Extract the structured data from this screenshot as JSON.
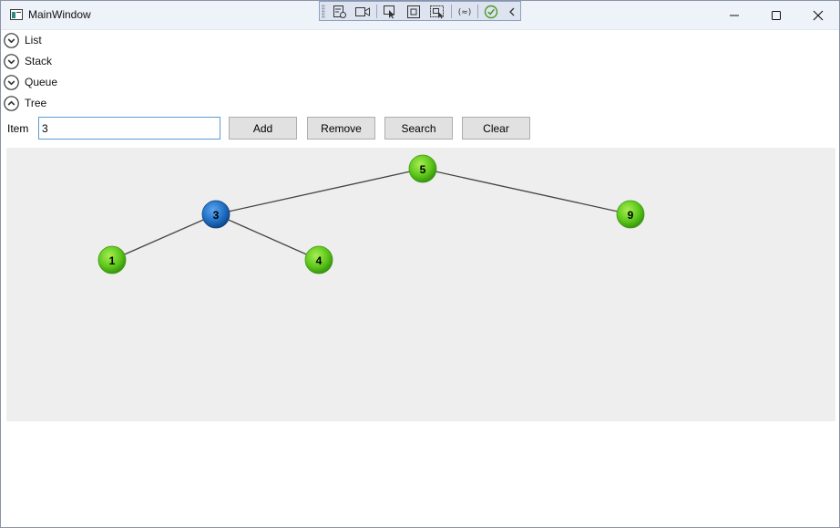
{
  "window": {
    "title": "MainWindow",
    "app_icon": "window-icon",
    "controls": [
      "minimize-icon",
      "maximize-icon",
      "close-icon"
    ]
  },
  "dev_toolbar": {
    "icons": [
      "live-visual-tree-icon",
      "record-icon",
      "select-element-icon",
      "display-layout-adorners-icon",
      "track-focus-icon",
      "binding-failures-icon",
      "check-icon",
      "collapse-chevron-icon"
    ]
  },
  "expanders": [
    {
      "label": "List",
      "expanded": false
    },
    {
      "label": "Stack",
      "expanded": false
    },
    {
      "label": "Queue",
      "expanded": false
    },
    {
      "label": "Tree",
      "expanded": true
    }
  ],
  "controls": {
    "item_label": "Item",
    "item_value": "3",
    "add_label": "Add",
    "remove_label": "Remove",
    "search_label": "Search",
    "clear_label": "Clear"
  },
  "tree": {
    "nodes": [
      {
        "id": "n5",
        "label": "5",
        "highlighted": false
      },
      {
        "id": "n3",
        "label": "3",
        "highlighted": true
      },
      {
        "id": "n9",
        "label": "9",
        "highlighted": false
      },
      {
        "id": "n1",
        "label": "1",
        "highlighted": false
      },
      {
        "id": "n4",
        "label": "4",
        "highlighted": false
      }
    ],
    "edges": [
      [
        "n5",
        "n3"
      ],
      [
        "n5",
        "n9"
      ],
      [
        "n3",
        "n1"
      ],
      [
        "n3",
        "n4"
      ]
    ],
    "colors": {
      "node": "#5cc61a",
      "highlight": "#1f6fc4",
      "edge": "#444444",
      "canvas": "#eeeeee"
    }
  }
}
